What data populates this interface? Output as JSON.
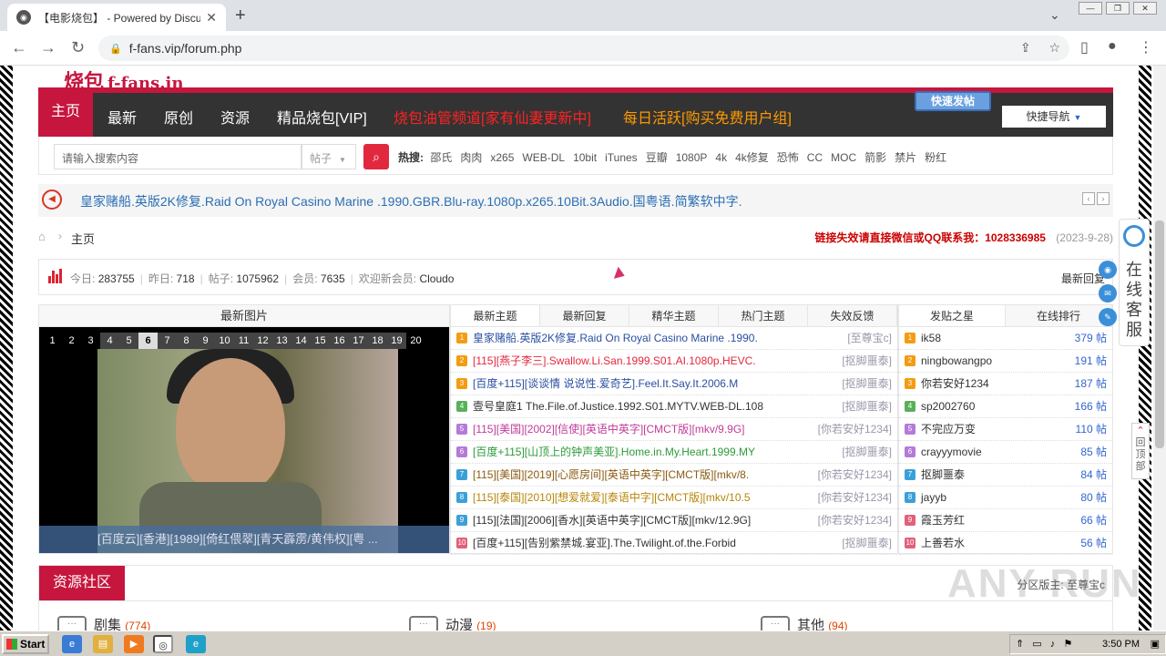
{
  "browser": {
    "tab_title": "【电影烧包】 - Powered by Discuz!",
    "tab_close": "✕",
    "new_tab": "+",
    "url": "f-fans.vip/forum.php",
    "tabs_menu": "⌄"
  },
  "site": {
    "logo_cn": "烧包",
    "logo_en": "f-fans.in"
  },
  "nav": {
    "items": [
      "主页",
      "最新",
      "原创",
      "资源",
      "精品烧包[VIP]"
    ],
    "promo_red": "烧包油管频道[家有仙妻更新中]",
    "promo_orange": "每日活跃[购买免费用户组]",
    "quick_post": "快速发帖",
    "quick_nav": "快捷导航"
  },
  "search": {
    "placeholder": "请输入搜索内容",
    "type": "帖子",
    "hot_label": "热搜:",
    "hot": [
      "邵氏",
      "肉肉",
      "x265",
      "WEB-DL",
      "10bit",
      "iTunes",
      "豆瓣",
      "1080P",
      "4k",
      "4k修复",
      "恐怖",
      "CC",
      "MOC",
      "箭影",
      "禁片",
      "粉红"
    ]
  },
  "notice": {
    "text": "皇家赌船.英版2K修复.Raid On Royal Casino Marine .1990.GBR.Blu-ray.1080p.x265.10Bit.3Audio.国粤语.简繁软中字."
  },
  "breadcrumb": {
    "home": "主页",
    "alert": "链接失效请直接微信或QQ联系我：1028336985",
    "date": "(2023-9-28)"
  },
  "stats": {
    "today_label": "今日:",
    "today": "283755",
    "yesterday_label": "昨日:",
    "yesterday": "718",
    "posts_label": "帖子:",
    "posts": "1075962",
    "members_label": "会员:",
    "members": "7635",
    "welcome_label": "欢迎新会员:",
    "welcome": "Cloudo",
    "right": "最新回复"
  },
  "photos": {
    "header": "最新图片",
    "pages": [
      "1",
      "2",
      "3",
      "4",
      "5",
      "6",
      "7",
      "8",
      "9",
      "10",
      "11",
      "12",
      "13",
      "14",
      "15",
      "16",
      "17",
      "18",
      "19",
      "20"
    ],
    "current_page": "6",
    "caption": "[百度云][香港][1989][倚红偎翠][青天霹雳/黄伟权][粤 ..."
  },
  "thread_tabs": [
    "最新主题",
    "最新回复",
    "精华主题",
    "热门主题",
    "失效反馈"
  ],
  "threads": [
    {
      "n": "1",
      "title": "皇家赌船.英版2K修复.Raid On Royal Casino Marine .1990.",
      "author": "[至尊宝c]",
      "color": "#2a4fa0",
      "badge": "#f39c12"
    },
    {
      "n": "2",
      "title": "[115][燕子李三].Swallow.Li.San.1999.S01.AI.1080p.HEVC.",
      "author": "[抠脚噩泰]",
      "color": "#e2283e",
      "badge": "#f39c12"
    },
    {
      "n": "3",
      "title": "[百度+115][谈谈情 说说性.爱奇艺].Feel.It.Say.It.2006.M",
      "author": "[抠脚噩泰]",
      "color": "#2a4fa0",
      "badge": "#f39c12"
    },
    {
      "n": "4",
      "title": "壹号皇庭1 The.File.of.Justice.1992.S01.MYTV.WEB-DL.108",
      "author": "[抠脚噩泰]",
      "color": "#333333",
      "badge": "#5ab05a"
    },
    {
      "n": "5",
      "title": "[115][美国][2002][信使][英语中英字][CMCT版][mkv/9.9G]",
      "author": "[你若安好1234]",
      "color": "#c23a9a",
      "badge": "#b57ad8"
    },
    {
      "n": "6",
      "title": "[百度+115][山顶上的钟声美亚].Home.in.My.Heart.1999.MY",
      "author": "[抠脚噩泰]",
      "color": "#2e9a3a",
      "badge": "#b57ad8"
    },
    {
      "n": "7",
      "title": "[115][美国][2019][心愿房间][英语中英字][CMCT版][mkv/8.",
      "author": "[你若安好1234]",
      "color": "#8a5a12",
      "badge": "#3ba0d8"
    },
    {
      "n": "8",
      "title": "[115][泰国][2010][想爱就爱][泰语中字][CMCT版][mkv/10.5",
      "author": "[你若安好1234]",
      "color": "#b8860b",
      "badge": "#3ba0d8"
    },
    {
      "n": "9",
      "title": "[115][法国][2006][香水][英语中英字][CMCT版][mkv/12.9G]",
      "author": "[你若安好1234]",
      "color": "#333333",
      "badge": "#3ba0d8"
    },
    {
      "n": "10",
      "title": "[百度+115][告别紫禁城.宴亚].The.Twilight.of.the.Forbid",
      "author": "[抠脚噩泰]",
      "color": "#333333",
      "badge": "#e2607a"
    }
  ],
  "rank_tabs": [
    "发贴之星",
    "在线排行"
  ],
  "ranks": [
    {
      "n": "1",
      "name": "ik58",
      "count": "379 帖",
      "badge": "#f39c12"
    },
    {
      "n": "2",
      "name": "ningbowangpo",
      "count": "191 帖",
      "badge": "#f39c12"
    },
    {
      "n": "3",
      "name": "你若安好1234",
      "count": "187 帖",
      "badge": "#f39c12"
    },
    {
      "n": "4",
      "name": "sp2002760",
      "count": "166 帖",
      "badge": "#5ab05a"
    },
    {
      "n": "5",
      "name": "不完应万变",
      "count": "110 帖",
      "badge": "#b57ad8"
    },
    {
      "n": "6",
      "name": "crayyymovie",
      "count": "85 帖",
      "badge": "#b57ad8"
    },
    {
      "n": "7",
      "name": "抠脚噩泰",
      "count": "84 帖",
      "badge": "#3ba0d8"
    },
    {
      "n": "8",
      "name": "jayyb",
      "count": "80 帖",
      "badge": "#3ba0d8"
    },
    {
      "n": "9",
      "name": "霞玉芳红",
      "count": "66 帖",
      "badge": "#e2607a"
    },
    {
      "n": "10",
      "name": "上善若水",
      "count": "56 帖",
      "badge": "#e2607a"
    }
  ],
  "section": {
    "title": "资源社区",
    "moderator": "分区版主: 至尊宝c",
    "forums": [
      {
        "name": "剧集",
        "count": "(774)"
      },
      {
        "name": "动漫",
        "count": "(19)"
      },
      {
        "name": "其他",
        "count": "(94)"
      }
    ]
  },
  "side": {
    "service": "在线客服",
    "back_top": "回顶部"
  },
  "taskbar": {
    "start": "Start",
    "time": "3:50 PM"
  },
  "watermark": "ANY RUN"
}
